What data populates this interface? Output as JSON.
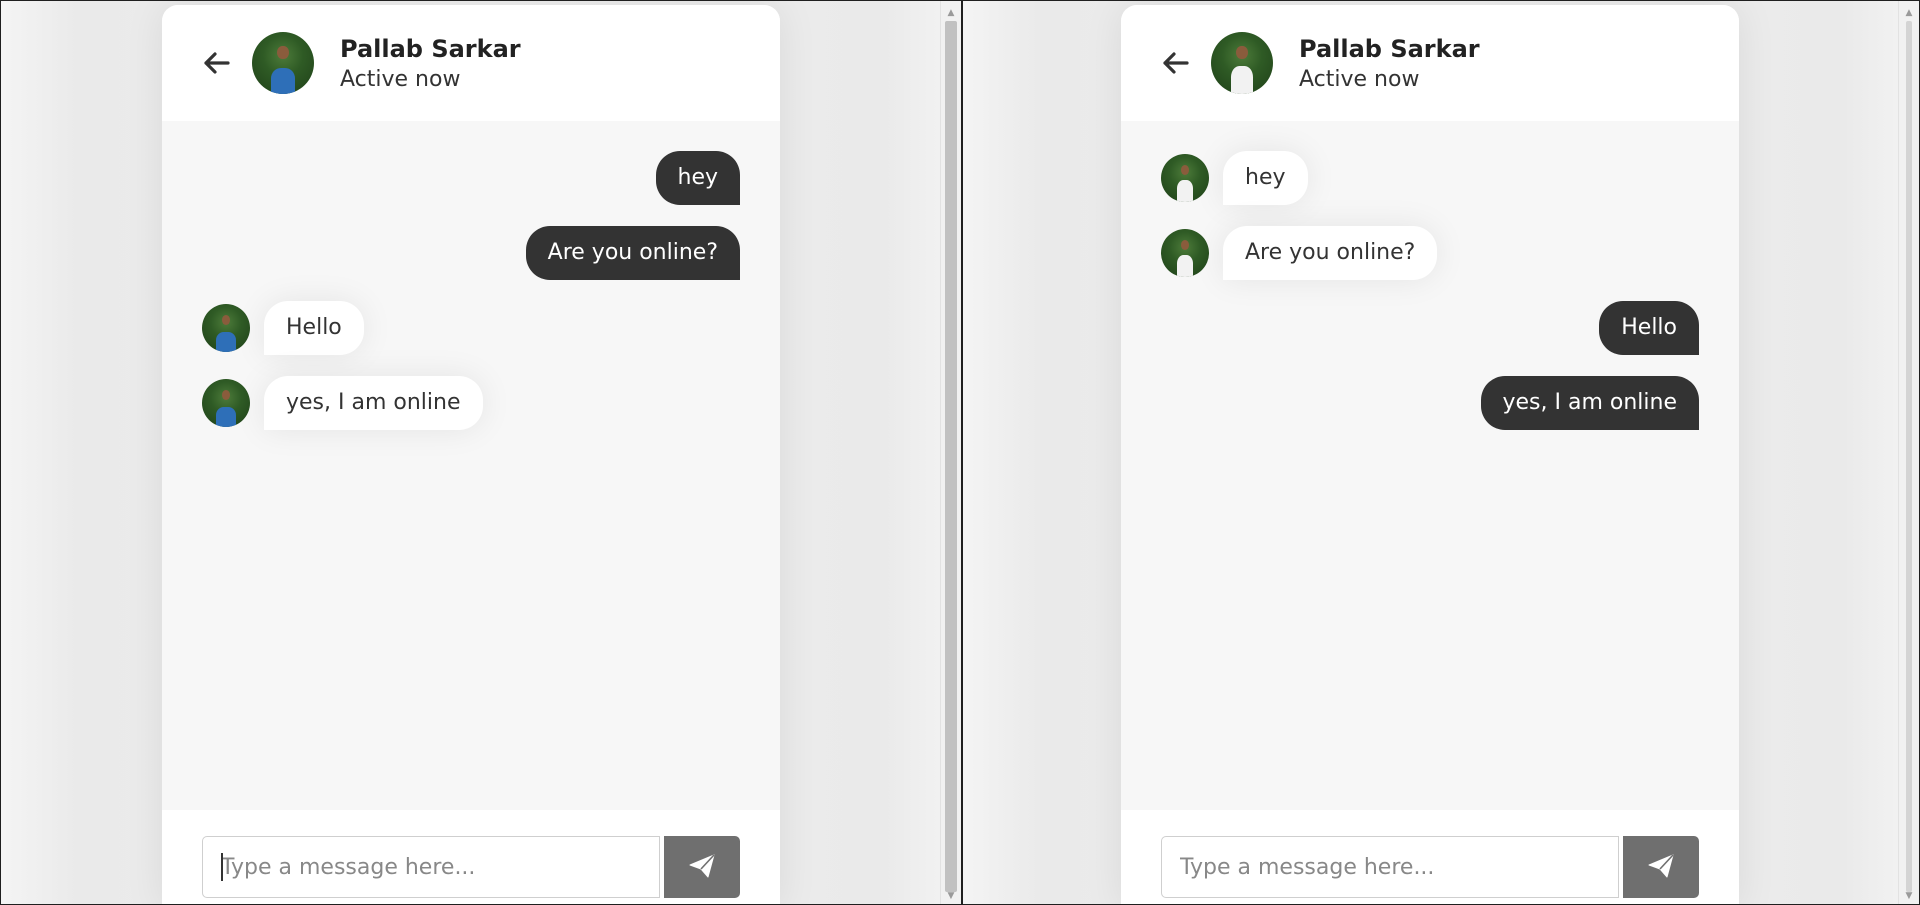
{
  "left_window": {
    "header": {
      "name": "Pallab Sarkar",
      "status": "Active now"
    },
    "messages": [
      {
        "text": "hey",
        "direction": "outgoing"
      },
      {
        "text": "Are you online?",
        "direction": "outgoing"
      },
      {
        "text": "Hello",
        "direction": "incoming"
      },
      {
        "text": "yes, I am online",
        "direction": "incoming"
      }
    ],
    "input": {
      "placeholder": "Type a message here...",
      "value": ""
    }
  },
  "right_window": {
    "header": {
      "name": "Pallab Sarkar",
      "status": "Active now"
    },
    "messages": [
      {
        "text": "hey",
        "direction": "incoming"
      },
      {
        "text": "Are you online?",
        "direction": "incoming"
      },
      {
        "text": "Hello",
        "direction": "outgoing"
      },
      {
        "text": "yes, I am online",
        "direction": "outgoing"
      }
    ],
    "input": {
      "placeholder": "Type a message here...",
      "value": ""
    }
  },
  "icons": {
    "back": "arrow-left-icon",
    "send": "paper-plane-icon"
  },
  "colors": {
    "outgoing_bubble": "#333333",
    "incoming_bubble": "#ffffff",
    "send_button": "#6f6f6f",
    "chat_bg": "#f7f7f7"
  }
}
